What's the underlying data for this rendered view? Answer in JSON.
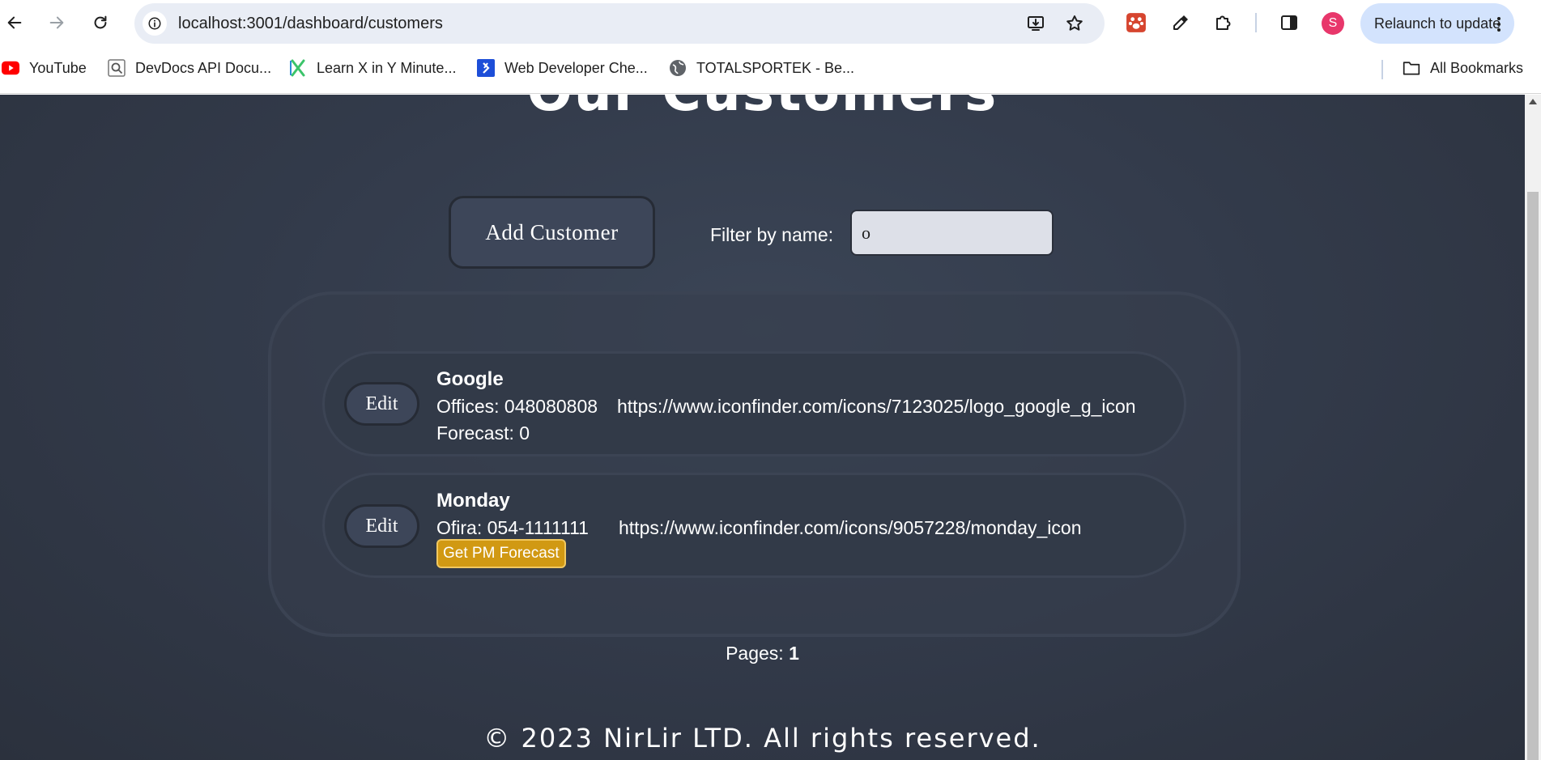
{
  "browser": {
    "url": "localhost:3001/dashboard/customers",
    "profile_initial": "S",
    "relaunch_label": "Relaunch to update",
    "bookmarks": [
      {
        "label": "YouTube",
        "icon": "youtube-icon"
      },
      {
        "label": "DevDocs API Docu...",
        "icon": "devdocs-icon"
      },
      {
        "label": "Learn X in Y Minute...",
        "icon": "learnx-icon"
      },
      {
        "label": "Web Developer Che...",
        "icon": "webdev-icon"
      },
      {
        "label": "TOTALSPORTEK - Be...",
        "icon": "globe-icon"
      }
    ],
    "all_bookmarks_label": "All Bookmarks"
  },
  "page": {
    "title": "Our Customers",
    "add_customer_label": "Add Customer",
    "filter_label": "Filter by name:",
    "filter_value": "o",
    "customers": [
      {
        "edit_label": "Edit",
        "name": "Google",
        "contact": "Offices: 048080808",
        "url": "https://www.iconfinder.com/icons/7123025/logo_google_g_icon",
        "forecast": "Forecast: 0"
      },
      {
        "edit_label": "Edit",
        "name": "Monday",
        "contact": "Ofira: 054-1111111",
        "url": "https://www.iconfinder.com/icons/9057228/monday_icon",
        "forecast_button": "Get PM Forecast"
      }
    ],
    "pages_label": "Pages:",
    "pages_value": "1",
    "footer": "© 2023 NirLir LTD. All rights reserved."
  },
  "colors": {
    "page_background": "#333b4b",
    "button_background": "#3d4659",
    "forecast_button": "#d19913",
    "omnibox": "#e9edf5",
    "relaunch": "#d3e3fd",
    "profile": "#e8376b"
  }
}
